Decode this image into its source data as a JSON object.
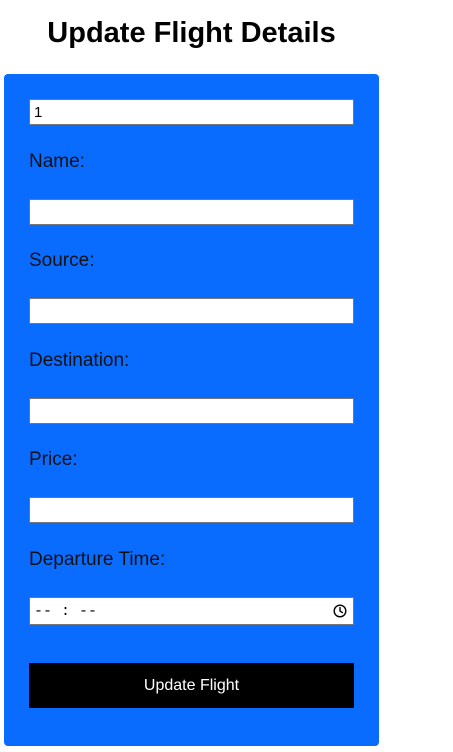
{
  "page": {
    "title": "Update Flight Details"
  },
  "form": {
    "id_value": "1",
    "name_label": "Name:",
    "name_value": "",
    "source_label": "Source:",
    "source_value": "",
    "destination_label": "Destination:",
    "destination_value": "",
    "price_label": "Price:",
    "price_value": "",
    "departure_label": "Departure Time:",
    "departure_placeholder": "-- : --",
    "submit_label": "Update Flight"
  },
  "colors": {
    "panel": "#0a6cff",
    "button": "#000000",
    "button_text": "#ffffff"
  }
}
